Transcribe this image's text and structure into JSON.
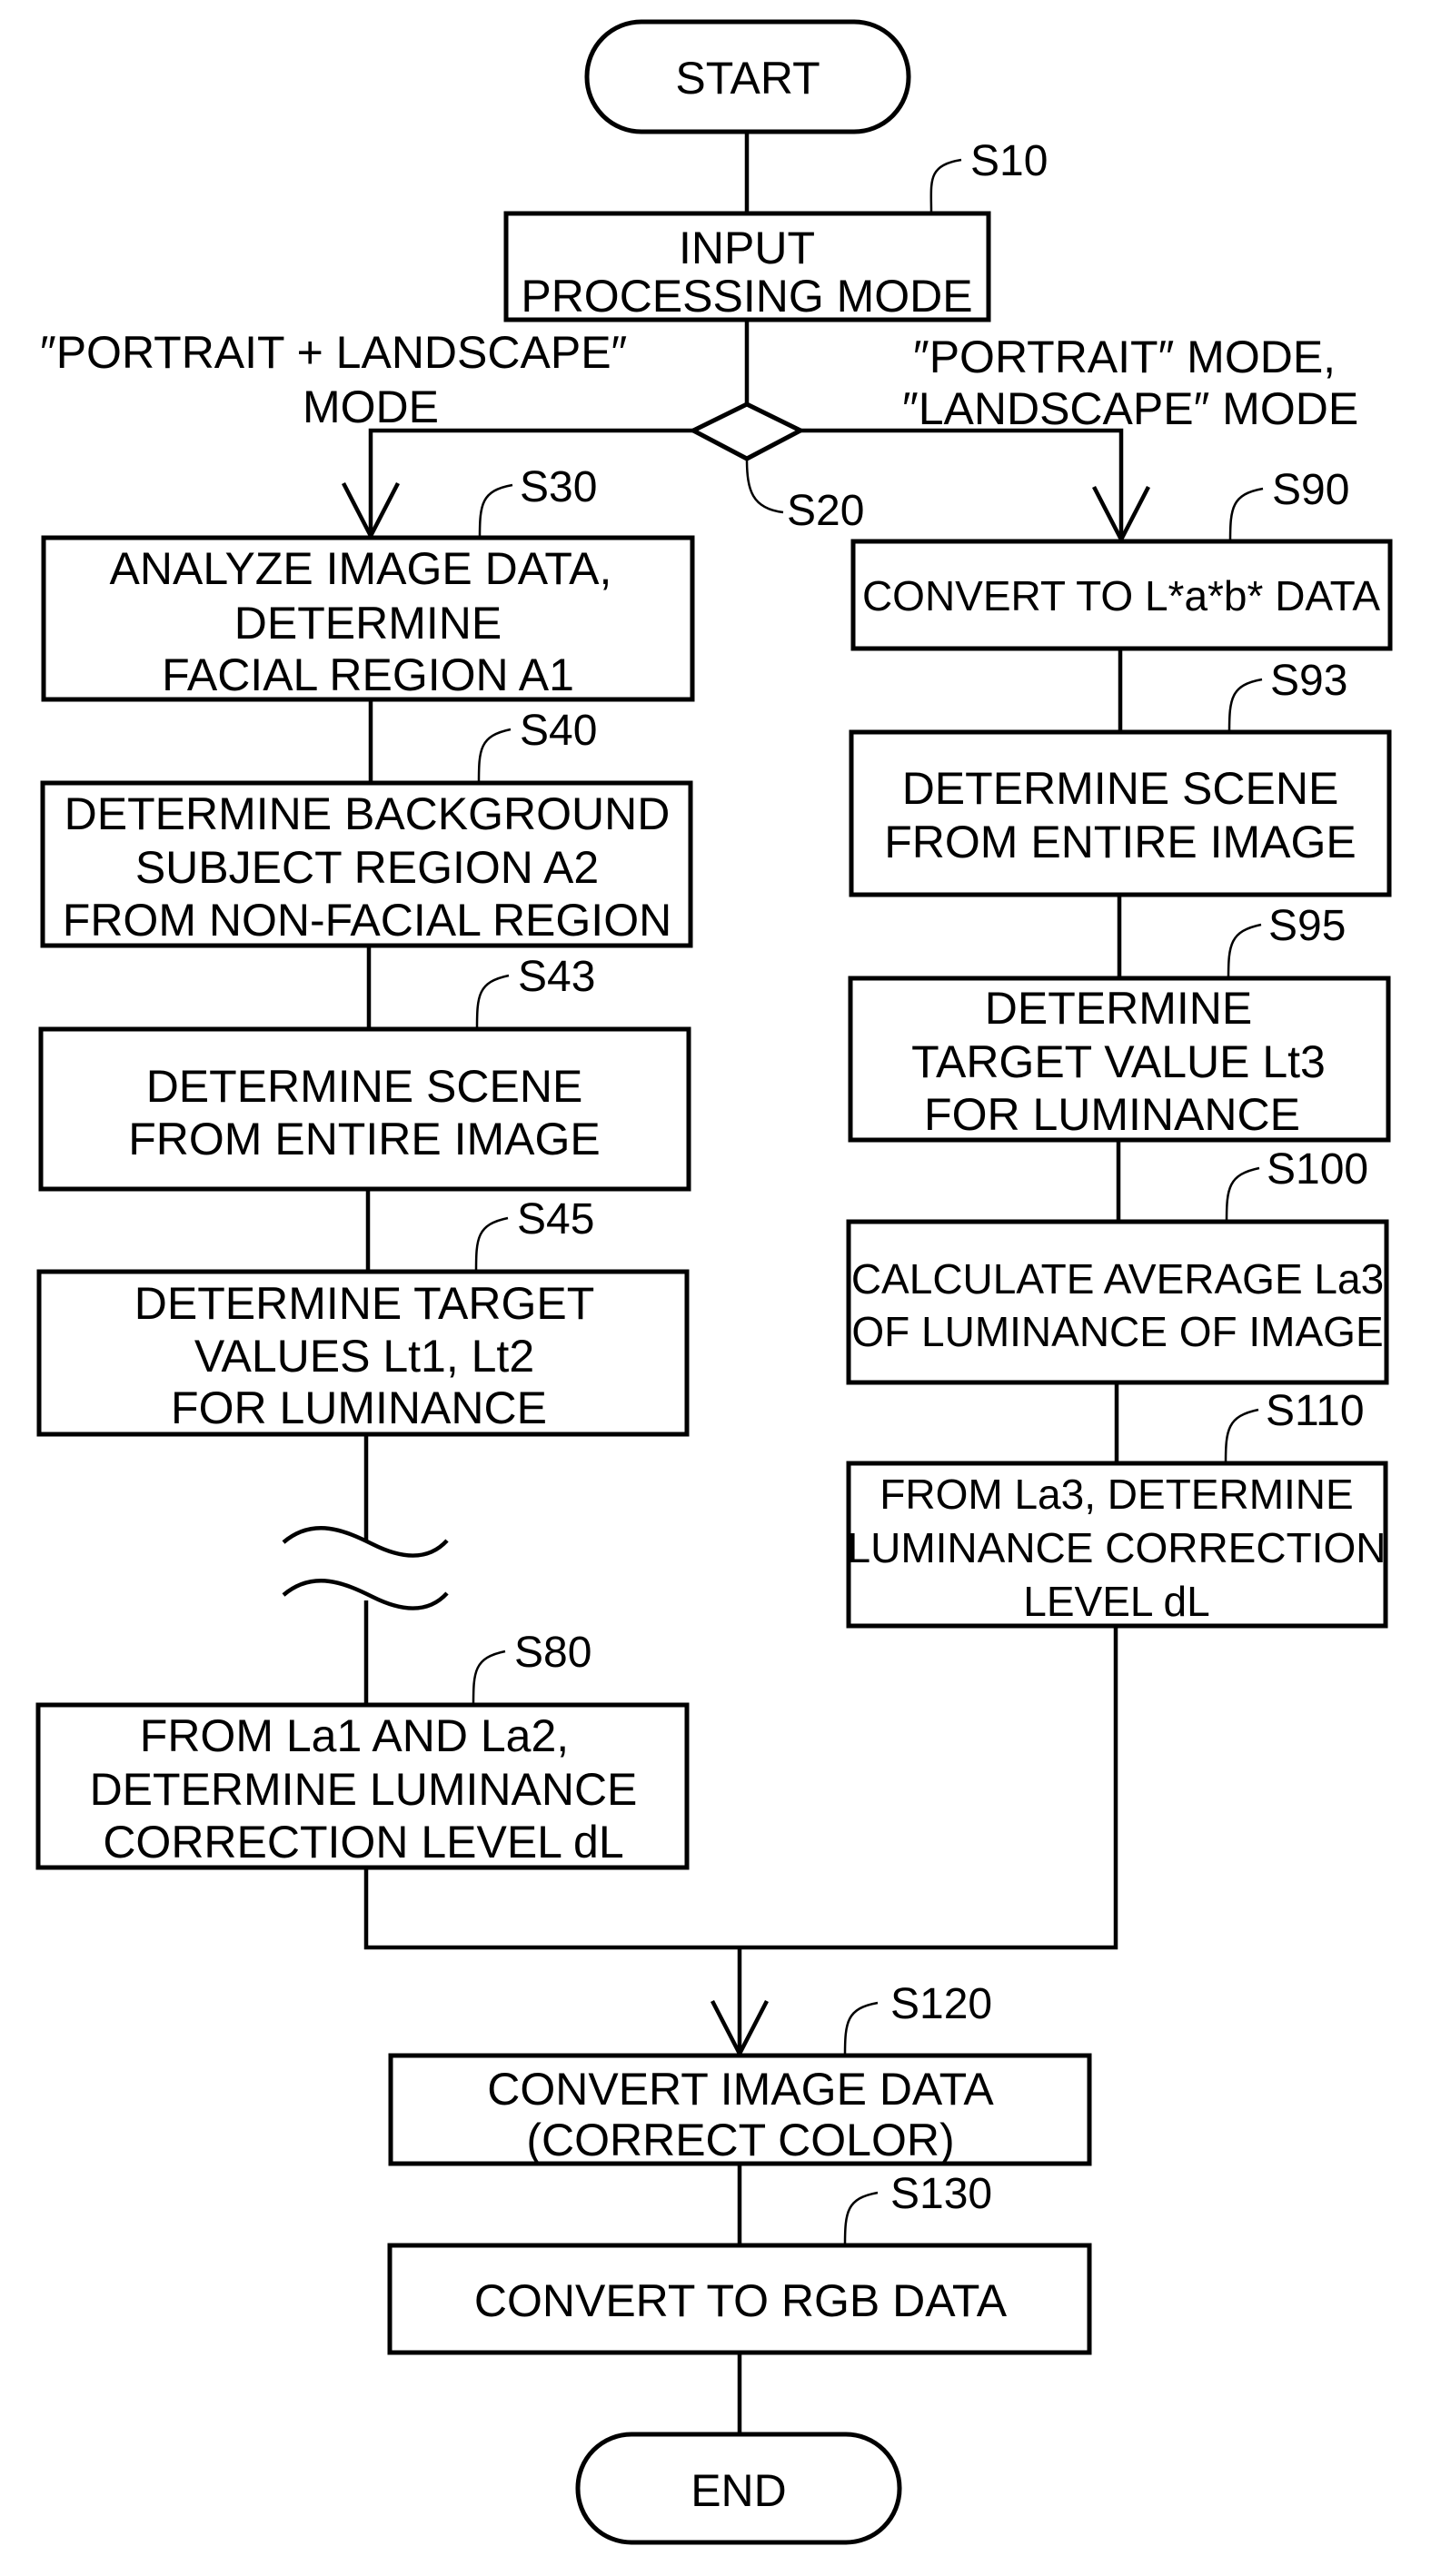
{
  "flowchart": {
    "start": "START",
    "end": "END",
    "steps": {
      "s10": {
        "id": "S10",
        "lines": [
          "INPUT",
          "PROCESSING MODE"
        ]
      },
      "s20": {
        "id": "S20"
      },
      "s30": {
        "id": "S30",
        "lines": [
          "ANALYZE IMAGE DATA,",
          "DETERMINE",
          "FACIAL REGION A1"
        ]
      },
      "s40": {
        "id": "S40",
        "lines": [
          "DETERMINE BACKGROUND",
          "SUBJECT REGION A2",
          "FROM NON-FACIAL REGION"
        ]
      },
      "s43": {
        "id": "S43",
        "lines": [
          "DETERMINE SCENE",
          "FROM ENTIRE IMAGE"
        ]
      },
      "s45": {
        "id": "S45",
        "lines": [
          "DETERMINE TARGET",
          "VALUES Lt1, Lt2",
          "FOR LUMINANCE"
        ]
      },
      "s80": {
        "id": "S80",
        "lines": [
          "FROM La1 AND La2,",
          "DETERMINE LUMINANCE",
          "CORRECTION LEVEL dL"
        ]
      },
      "s90": {
        "id": "S90",
        "lines": [
          "CONVERT TO L*a*b* DATA"
        ]
      },
      "s93": {
        "id": "S93",
        "lines": [
          "DETERMINE SCENE",
          "FROM ENTIRE IMAGE"
        ]
      },
      "s95": {
        "id": "S95",
        "lines": [
          "DETERMINE",
          "TARGET VALUE Lt3",
          "FOR LUMINANCE"
        ]
      },
      "s100": {
        "id": "S100",
        "lines": [
          "CALCULATE AVERAGE La3",
          "OF LUMINANCE OF IMAGE"
        ]
      },
      "s110": {
        "id": "S110",
        "lines": [
          "FROM La3, DETERMINE",
          "LUMINANCE CORRECTION",
          "LEVEL dL"
        ]
      },
      "s120": {
        "id": "S120",
        "lines": [
          "CONVERT IMAGE DATA",
          "(CORRECT COLOR)"
        ]
      },
      "s130": {
        "id": "S130",
        "lines": [
          "CONVERT TO RGB DATA"
        ]
      }
    },
    "branches": {
      "left": [
        "″PORTRAIT + LANDSCAPE″",
        "MODE"
      ],
      "right": [
        "″PORTRAIT″ MODE,",
        "″LANDSCAPE″ MODE"
      ]
    }
  }
}
